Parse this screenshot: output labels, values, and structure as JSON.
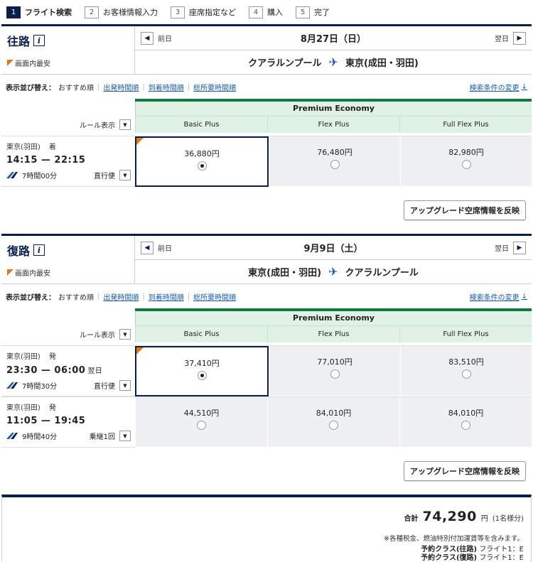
{
  "steps": [
    {
      "num": "1",
      "label": "フライト検索",
      "active": true
    },
    {
      "num": "2",
      "label": "お客様情報入力"
    },
    {
      "num": "3",
      "label": "座席指定など"
    },
    {
      "num": "4",
      "label": "購入"
    },
    {
      "num": "5",
      "label": "完了"
    }
  ],
  "common": {
    "prev": "前日",
    "next": "翌日",
    "cheapest": "画面内最安",
    "sort_label": "表示並び替え：",
    "sort_current": "おすすめ順",
    "sort_departure": "出発時間順",
    "sort_arrival": "到着時間順",
    "sort_duration": "総所要時間順",
    "change_conditions": "検索条件の変更",
    "rule_display": "ルール表示",
    "cabin": "Premium Economy",
    "fare_types": [
      "Basic Plus",
      "Flex Plus",
      "Full Flex Plus"
    ],
    "upgrade_button": "アップグレード空席情報を反映"
  },
  "outbound": {
    "title": "往路",
    "date": "8月27日（日）",
    "from": "クアラルンプール",
    "to": "東京(成田・羽田)",
    "flights": [
      {
        "airport": "東京(羽田)",
        "tag": "着",
        "time": "14:15 — 22:15",
        "next_day": "",
        "duration": "7時間00分",
        "type": "直行便",
        "fares": [
          "36,880円",
          "76,480円",
          "82,980円"
        ],
        "selected": 0,
        "cheapest": 0
      }
    ]
  },
  "return": {
    "title": "復路",
    "date": "9月9日（土）",
    "from": "東京(成田・羽田)",
    "to": "クアラルンプール",
    "flights": [
      {
        "airport": "東京(羽田)",
        "tag": "発",
        "time": "23:30 — 06:00",
        "next_day": "翌日",
        "duration": "7時間30分",
        "type": "直行便",
        "fares": [
          "37,410円",
          "77,010円",
          "83,510円"
        ],
        "selected": 0,
        "cheapest": 0
      },
      {
        "airport": "東京(羽田)",
        "tag": "発",
        "time": "11:05 — 19:45",
        "next_day": "",
        "duration": "9時間40分",
        "type": "乗継1回",
        "fares": [
          "44,510円",
          "84,010円",
          "84,010円"
        ],
        "selected": -1,
        "cheapest": -1
      }
    ]
  },
  "summary": {
    "total_label": "合計",
    "total_amount": "74,290",
    "yen": "円",
    "pax": "(1名様分)",
    "tax_note": "※各種税金、燃油特別付加運賃等を含みます。",
    "class_out_label": "予約クラス(往路)",
    "class_out_value": "フライト1：E",
    "class_ret_label": "予約クラス(復路)",
    "class_ret_value": "フライト1：E"
  },
  "colors": {
    "navy": "#0b1f4d",
    "green": "#107a3e",
    "orange": "#e07a1f",
    "link": "#1b5ca8"
  }
}
